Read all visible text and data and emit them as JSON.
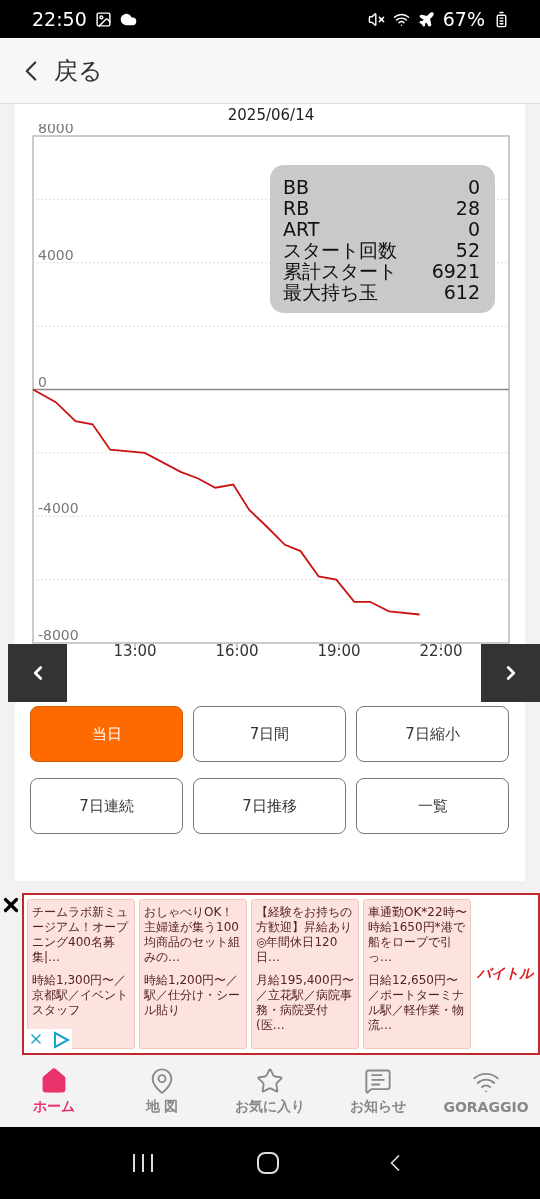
{
  "status_bar": {
    "time": "22:50",
    "battery": "67%"
  },
  "header": {
    "back": "戻る"
  },
  "date": "2025/06/14",
  "chart_data": {
    "type": "line",
    "xlim": [
      10,
      24
    ],
    "ylim": [
      -8000,
      8000
    ],
    "xticks": [
      {
        "value": 13,
        "label": "13:00"
      },
      {
        "value": 16,
        "label": "16:00"
      },
      {
        "value": 19,
        "label": "19:00"
      },
      {
        "value": 22,
        "label": "22:00"
      }
    ],
    "yticks": [
      8000,
      4000,
      0,
      -4000,
      -8000
    ],
    "x": [
      10.0,
      10.67,
      11.25,
      11.75,
      12.27,
      13.29,
      14.34,
      14.84,
      15.36,
      15.89,
      16.36,
      16.85,
      17.41,
      17.87,
      18.4,
      18.92,
      19.45,
      19.91,
      20.47,
      21.37
    ],
    "series": [
      {
        "color": "#cc1111",
        "values": [
          0,
          -400,
          -1000,
          -1100,
          -1900,
          -2000,
          -2600,
          -2800,
          -3100,
          -3000,
          -3800,
          -4300,
          -4900,
          -5100,
          -5900,
          -6000,
          -6700,
          -6700,
          -7000,
          -7100
        ]
      }
    ]
  },
  "stats": [
    {
      "label": "BB",
      "value": "0"
    },
    {
      "label": "RB",
      "value": "28"
    },
    {
      "label": "ART",
      "value": "0"
    },
    {
      "label": "スタート回数",
      "value": "52"
    },
    {
      "label": "累計スタート",
      "value": "6921"
    },
    {
      "label": "最大持ち玉",
      "value": "612"
    }
  ],
  "buttons": [
    {
      "label": "当日",
      "selected": true
    },
    {
      "label": "7日間",
      "selected": false
    },
    {
      "label": "7日縮小",
      "selected": false
    },
    {
      "label": "7日連続",
      "selected": false
    },
    {
      "label": "7日推移",
      "selected": false
    },
    {
      "label": "一覧",
      "selected": false
    }
  ],
  "ad": {
    "cards": [
      {
        "title": "チームラボ新ミュージアム！オープニング400名募集|…",
        "detail": "時給1,300円〜／京都駅／イベントスタッフ"
      },
      {
        "title": "おしゃべりOK！主婦達が集う100均商品のセット組みの…",
        "detail": "時給1,200円〜／駅／仕分け・シール貼り"
      },
      {
        "title": "【経験をお持ちの方歓迎】昇給あり◎年間休日120日…",
        "detail": "月給195,400円〜／立花駅／病院事務・病院受付(医…"
      },
      {
        "title": "車通勤OK*22時〜時給1650円*港で船をロープで引っ…",
        "detail": "日給12,650円〜／ポートターミナル駅／軽作業・物流…"
      }
    ],
    "logo": "バイトル"
  },
  "bottom_nav": [
    {
      "kind": "home",
      "label": "ホーム",
      "selected": true
    },
    {
      "kind": "map",
      "label": "地 図",
      "selected": false
    },
    {
      "kind": "star",
      "label": "お気に入り",
      "selected": false
    },
    {
      "kind": "message",
      "label": "お知らせ",
      "selected": false
    },
    {
      "kind": "wifi",
      "label": "GORAGGIO",
      "selected": false
    }
  ]
}
